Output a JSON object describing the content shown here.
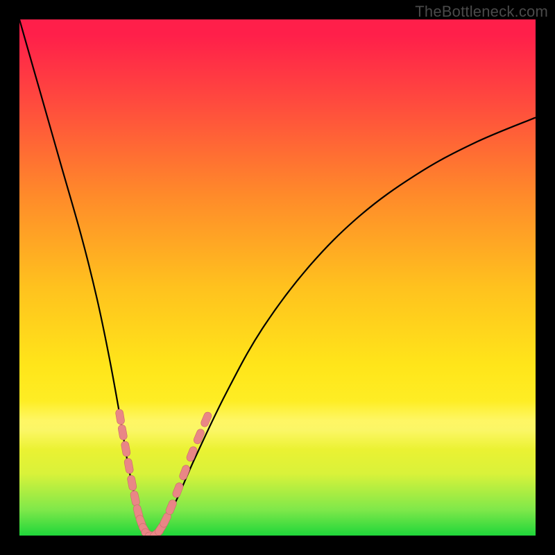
{
  "watermark": "TheBottleneck.com",
  "colors": {
    "frame": "#000000",
    "curve": "#000000",
    "marker_fill": "#e98686",
    "marker_stroke": "#c96a6a"
  },
  "chart_data": {
    "type": "line",
    "title": "",
    "xlabel": "",
    "ylabel": "",
    "xlim": [
      0,
      1
    ],
    "ylim": [
      0,
      1
    ],
    "grid": false,
    "legend": false,
    "curve_sampled_xy": [
      [
        0.0,
        1.0
      ],
      [
        0.04,
        0.86
      ],
      [
        0.08,
        0.72
      ],
      [
        0.12,
        0.58
      ],
      [
        0.15,
        0.46
      ],
      [
        0.175,
        0.34
      ],
      [
        0.195,
        0.23
      ],
      [
        0.21,
        0.14
      ],
      [
        0.225,
        0.07
      ],
      [
        0.24,
        0.02
      ],
      [
        0.255,
        0.0
      ],
      [
        0.27,
        0.01
      ],
      [
        0.3,
        0.06
      ],
      [
        0.34,
        0.15
      ],
      [
        0.4,
        0.275
      ],
      [
        0.47,
        0.4
      ],
      [
        0.56,
        0.52
      ],
      [
        0.66,
        0.62
      ],
      [
        0.77,
        0.7
      ],
      [
        0.88,
        0.76
      ],
      [
        1.0,
        0.81
      ]
    ],
    "markers_xy": [
      [
        0.195,
        0.23
      ],
      [
        0.2,
        0.2
      ],
      [
        0.206,
        0.168
      ],
      [
        0.212,
        0.135
      ],
      [
        0.218,
        0.102
      ],
      [
        0.224,
        0.072
      ],
      [
        0.23,
        0.045
      ],
      [
        0.236,
        0.025
      ],
      [
        0.243,
        0.01
      ],
      [
        0.25,
        0.002
      ],
      [
        0.258,
        0.0
      ],
      [
        0.266,
        0.004
      ],
      [
        0.274,
        0.014
      ],
      [
        0.283,
        0.03
      ],
      [
        0.294,
        0.055
      ],
      [
        0.307,
        0.088
      ],
      [
        0.32,
        0.122
      ],
      [
        0.334,
        0.158
      ],
      [
        0.348,
        0.192
      ],
      [
        0.362,
        0.225
      ]
    ]
  }
}
